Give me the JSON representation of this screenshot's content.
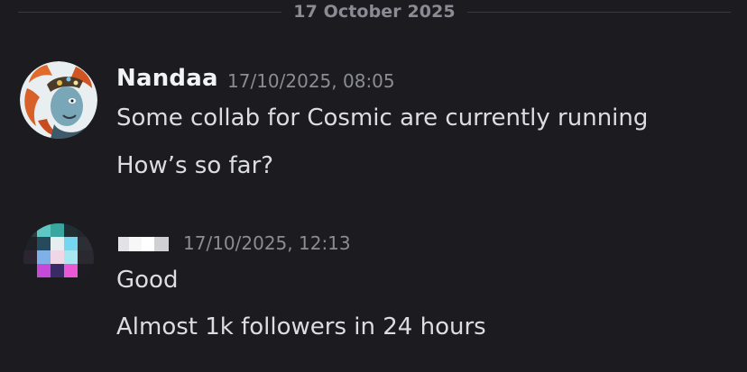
{
  "divider": {
    "date": "17 October 2025"
  },
  "messages": [
    {
      "author": "Nandaa",
      "timestamp": "17/10/2025, 08:05",
      "avatar_icon": "cartoon-avatar-icon",
      "lines": [
        "Some collab for Cosmic are currently running",
        "How’s so far?"
      ]
    },
    {
      "author": "",
      "author_redacted": true,
      "timestamp": "17/10/2025, 12:13",
      "avatar_icon": "pixelated-avatar-icon",
      "lines": [
        "Good",
        "Almost 1k followers in 24 hours"
      ]
    }
  ],
  "colors": {
    "background": "#1b1b20",
    "username": "#f2f3f5",
    "text": "#dcdde1",
    "timestamp": "#8b8c94",
    "divider": "#3a3b42"
  }
}
